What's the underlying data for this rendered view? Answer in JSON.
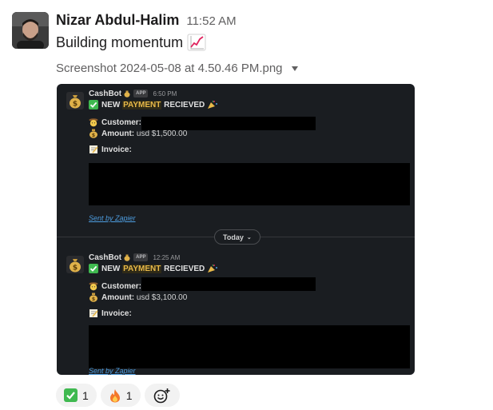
{
  "message": {
    "author": "Nizar Abdul-Halim",
    "time": "11:52 AM",
    "text": "Building momentum",
    "text_icon": "chart-increasing-icon",
    "file_name": "Screenshot 2024-05-08 at 4.50.46 PM.png"
  },
  "screenshot": {
    "divider_label": "Today",
    "messages": [
      {
        "bot_name": "CashBot",
        "badge": "APP",
        "time": "6:50 PM",
        "headline_prefix": "NEW",
        "headline_highlight": "PAYMENT",
        "headline_suffix": "RECIEVED",
        "customer_label": "Customer:",
        "amount_label": "Amount:",
        "amount_value": "usd $1,500.00",
        "invoice_label": "Invoice:",
        "sent_by": "Sent by Zapier"
      },
      {
        "bot_name": "CashBot",
        "badge": "APP",
        "time": "12:25 AM",
        "headline_prefix": "NEW",
        "headline_highlight": "PAYMENT",
        "headline_suffix": "RECIEVED",
        "customer_label": "Customer:",
        "amount_label": "Amount:",
        "amount_value": "usd $3,100.00",
        "invoice_label": "Invoice:",
        "sent_by": "Sent by Zapier"
      }
    ]
  },
  "reactions": [
    {
      "icon": "white-check-mark-icon",
      "count": "1"
    },
    {
      "icon": "fire-icon",
      "count": "1"
    }
  ],
  "add_reaction_icon": "add-reaction-icon",
  "colors": {
    "highlight": "#e8b949",
    "link": "#4d9de0",
    "check_green": "#3fb950",
    "dark_bg": "#1a1d21"
  }
}
